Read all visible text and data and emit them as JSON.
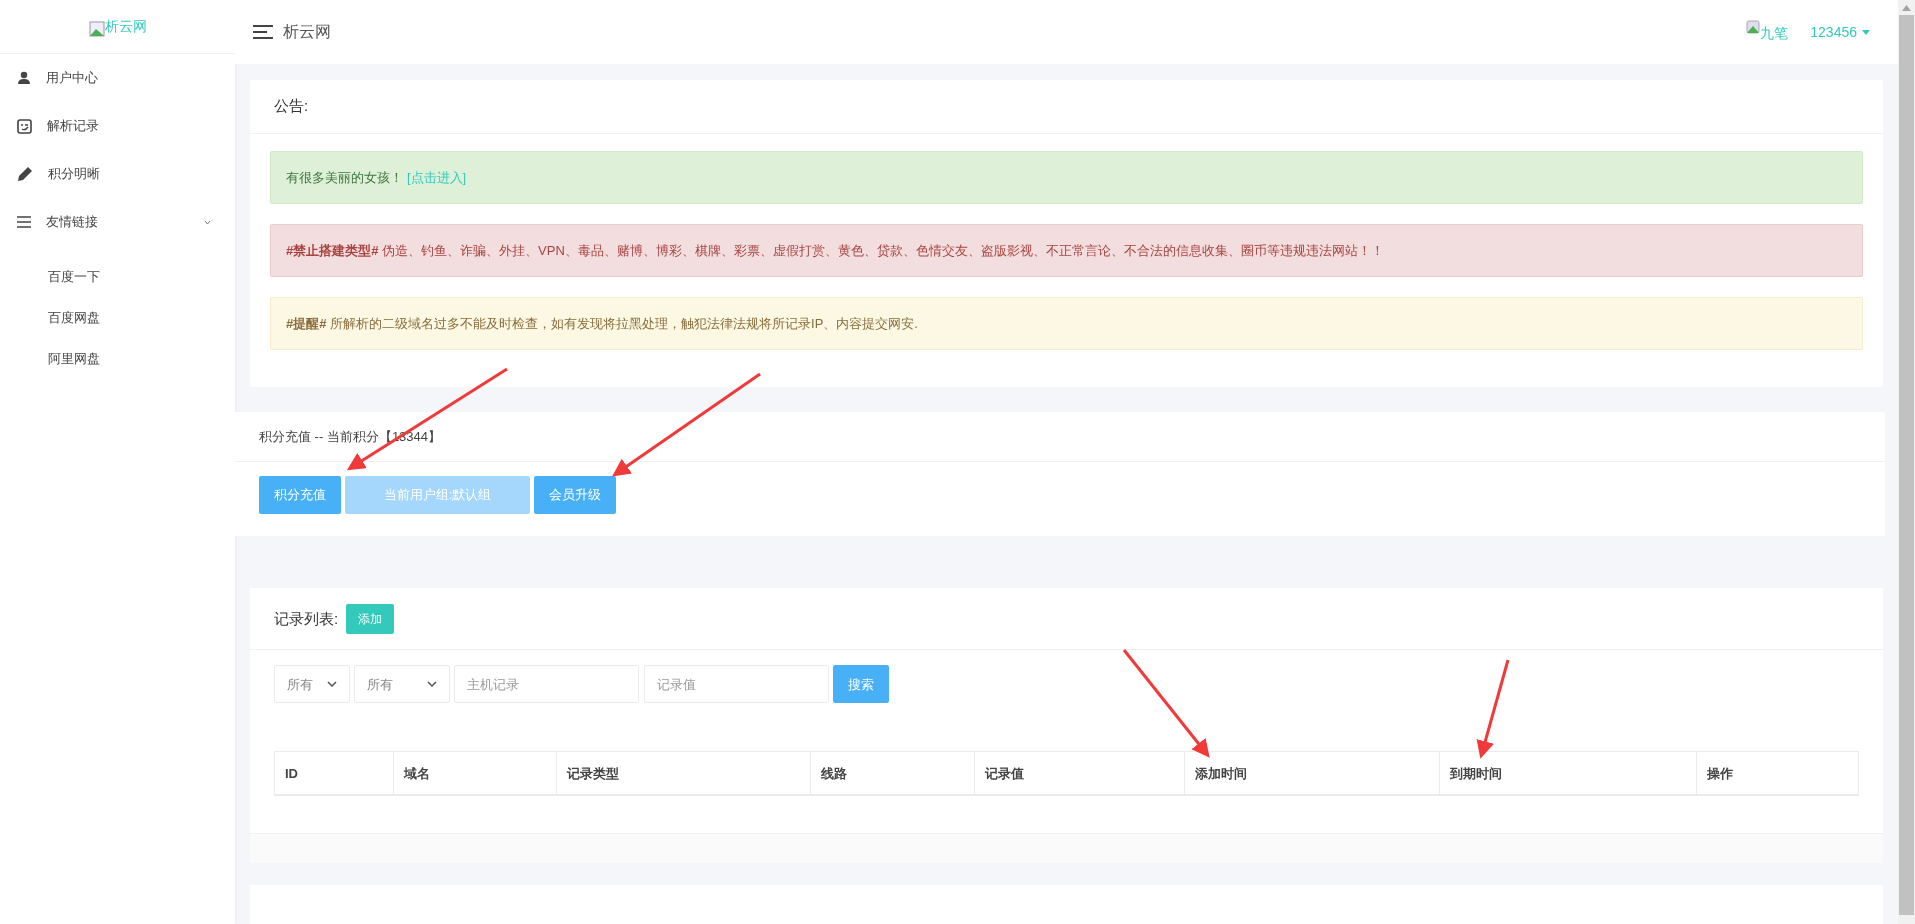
{
  "sidebar": {
    "logo": "析云网",
    "items": [
      {
        "label": "用户中心",
        "kind": "user"
      },
      {
        "label": "解析记录",
        "kind": "record"
      },
      {
        "label": "积分明晰",
        "kind": "pen"
      },
      {
        "label": "友情链接",
        "kind": "menu",
        "expanded": true,
        "children": [
          {
            "label": "百度一下"
          },
          {
            "label": "百度网盘"
          },
          {
            "label": "阿里网盘"
          }
        ]
      }
    ]
  },
  "header": {
    "title": "析云网",
    "user_name": "九笔",
    "account": "123456"
  },
  "notice": {
    "title": "公告:",
    "alerts": [
      {
        "kind": "success",
        "text": "有很多美丽的女孩！",
        "link": "[点击进入]"
      },
      {
        "kind": "danger",
        "text": "**#禁止搭建类型#** 伪造、钓鱼、诈骗、外挂、VPN、毒品、赌博、博彩、棋牌、彩票、虚假打赏、黄色、贷款、色情交友、盗版影视、不正常言论、不合法的信息收集、圈币等违规违法网站！！"
      },
      {
        "kind": "warning",
        "text": "**#提醒#** 所解析的二级域名过多不能及时检查，如有发现将拉黑处理，触犯法律法规将所记录IP、内容提交网安."
      }
    ]
  },
  "points": {
    "title": "积分充值 -- 当前积分【13344】",
    "buttons": [
      {
        "label": "积分充值",
        "disabled": false
      },
      {
        "label": "当前用户组:默认组",
        "disabled": true
      },
      {
        "label": "会员升级",
        "disabled": false
      }
    ]
  },
  "records": {
    "title": "记录列表:",
    "add_button": "添加",
    "filters": {
      "select_1": "所有",
      "select_2": "所有",
      "host_placeholder": "主机记录",
      "value_placeholder": "记录值",
      "search_button": "搜索"
    },
    "table": {
      "columns": [
        "ID",
        "域名",
        "记录类型",
        "线路",
        "记录值",
        "添加时间",
        "到期时间",
        "操作"
      ]
    }
  }
}
